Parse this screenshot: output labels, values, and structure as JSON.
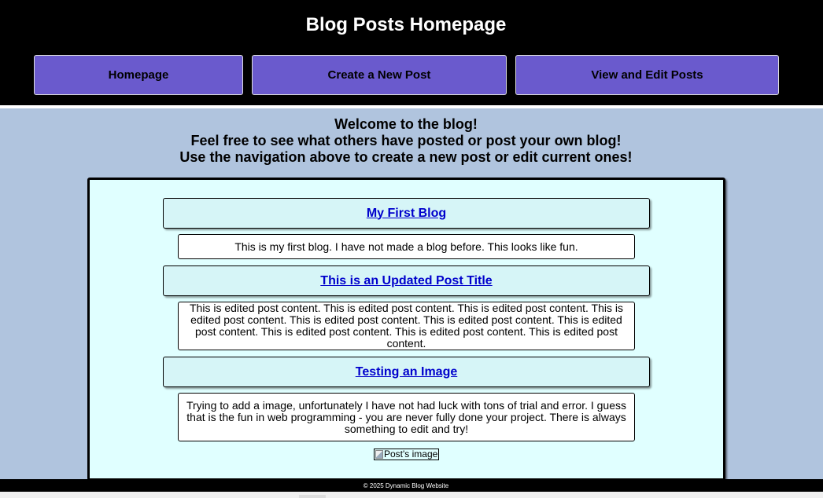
{
  "header": {
    "title": "Blog Posts Homepage",
    "nav": [
      {
        "label": "Homepage"
      },
      {
        "label": "Create a New Post"
      },
      {
        "label": "View and Edit Posts"
      }
    ]
  },
  "welcome": {
    "lines": [
      "Welcome to the blog!",
      "Feel free to see what others have posted or post your own blog!",
      "Use the navigation above to create a new post or edit current ones!"
    ]
  },
  "posts": [
    {
      "title": "My First Blog",
      "content": "This is my first blog. I have not made a blog before. This looks like fun."
    },
    {
      "title": "This is an Updated Post Title",
      "content": "This is edited post content. This is edited post content. This is edited post content. This is edited post content. This is edited post content. This is edited post content. This is edited post content. This is edited post content. This is edited post content. This is edited post content."
    },
    {
      "title": "Testing an Image",
      "content": "Trying to add a image, unfortunately I have not had luck with tons of trial and error. I guess that is the fun in web programming - you are never fully done your project. There is always something to edit and try!",
      "image_alt": "Post's image"
    }
  ],
  "footer": {
    "text": "© 2025 Dynamic Blog Website"
  },
  "colors": {
    "header_bg": "#000000",
    "nav_button": "#6a5acd",
    "page_bg": "#b0c4de",
    "posts_bg": "#e0ffff",
    "link": "#0000cc"
  }
}
